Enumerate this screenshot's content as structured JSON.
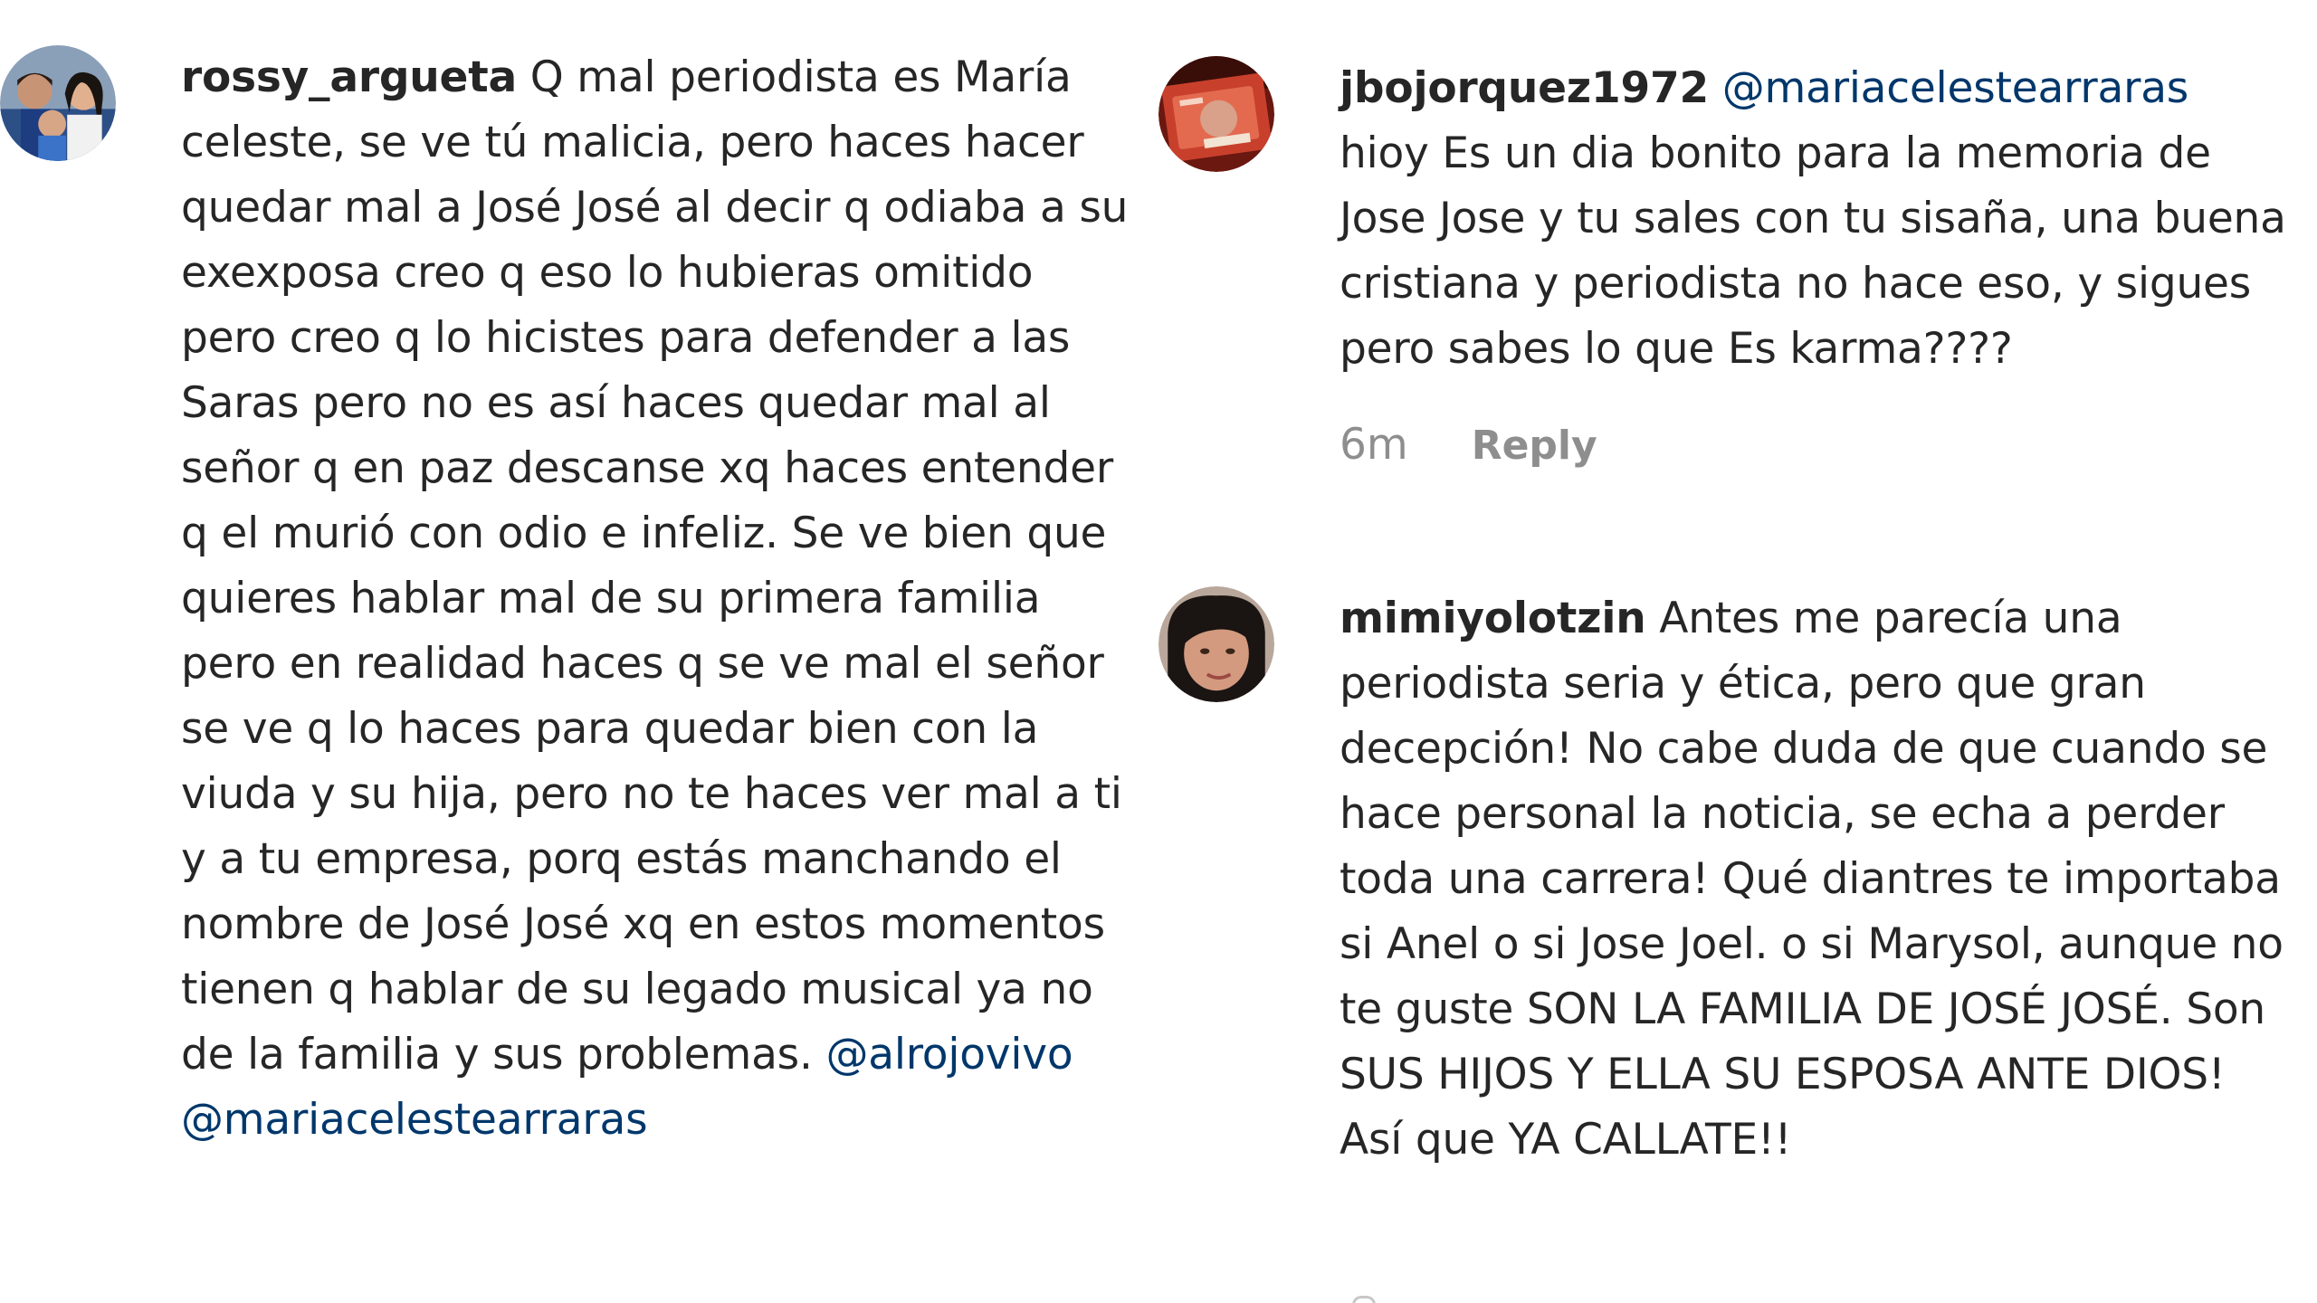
{
  "comments": [
    {
      "username": "rossy_argueta",
      "text": "Q mal periodista es María celeste, se ve tú malicia, pero haces hacer quedar mal a José José al decir q odiaba a su exexposa creo q eso lo hubieras omitido pero creo q lo hicistes para defender a las Saras pero no es así haces quedar mal al señor q en paz descanse xq haces entender q el murió con odio e infeliz. Se ve bien que quieres hablar mal de su primera familia pero en realidad haces q se ve mal el señor se ve q lo haces para quedar bien con la viuda y su hija, pero no te haces ver mal a ti y a tu empresa, porq estás manchando el nombre de José José xq en estos momentos tienen q hablar de su legado musical ya no de la familia y sus problemas.",
      "mention1": "@alrojovivo",
      "mention2": "@mariacelestearraras",
      "avatar_icon": "family-photo-avatar"
    },
    {
      "username": "jbojorquez1972",
      "mention": "@mariacelestearraras",
      "text": "hioy Es un dia bonito para la memoria de Jose Jose y tu sales con tu sisaña, una buena cristiana y periodista no hace eso, y sigues pero sabes lo que Es karma????",
      "time": "6m",
      "reply_label": "Reply",
      "avatar_icon": "record-album-avatar"
    },
    {
      "username": "mimiyolotzin",
      "text": "Antes me parecía una periodista seria y ética, pero que gran decepción! No cabe duda de que cuando se hace personal la noticia, se echa a perder toda una carrera! Qué diantres te importaba si Anel o si Jose Joel. o si Marysol, aunque no te guste SON LA FAMILIA DE JOSÉ JOSÉ. Son SUS HIJOS Y ELLA SU ESPOSA ANTE DIOS! Así que YA CALLATE!!",
      "avatar_icon": "woman-portrait-avatar"
    }
  ],
  "colors": {
    "text": "#262626",
    "mention": "#00376b",
    "meta": "#8e8e8e"
  }
}
